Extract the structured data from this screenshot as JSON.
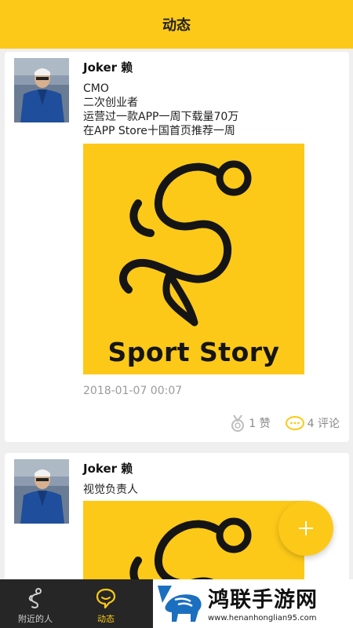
{
  "header": {
    "title": "动态"
  },
  "posts": [
    {
      "author": "Joker 赖",
      "lines": [
        "CMO",
        "二次创业者",
        "运营过一款APP一周下载量70万",
        "在APP Store十国首页推荐一周"
      ],
      "image_text": "Sport Story",
      "timestamp": "2018-01-07 00:07",
      "likes": "1 赞",
      "comments": "4 评论"
    },
    {
      "author": "Joker 赖",
      "lines": [
        "视觉负责人"
      ]
    }
  ],
  "fab": {
    "icon": "plus-icon"
  },
  "tabs": [
    {
      "label": "附近的人",
      "icon": "runner-icon"
    },
    {
      "label": "动态",
      "icon": "smiley-bubble-icon"
    }
  ],
  "watermark": {
    "text": "鸿联手游网",
    "url": "www.henanhonglian95.com",
    "icon": "bull-logo-icon"
  },
  "colors": {
    "accent": "#fdc918",
    "tabbar": "#262626",
    "background": "#efefef"
  }
}
